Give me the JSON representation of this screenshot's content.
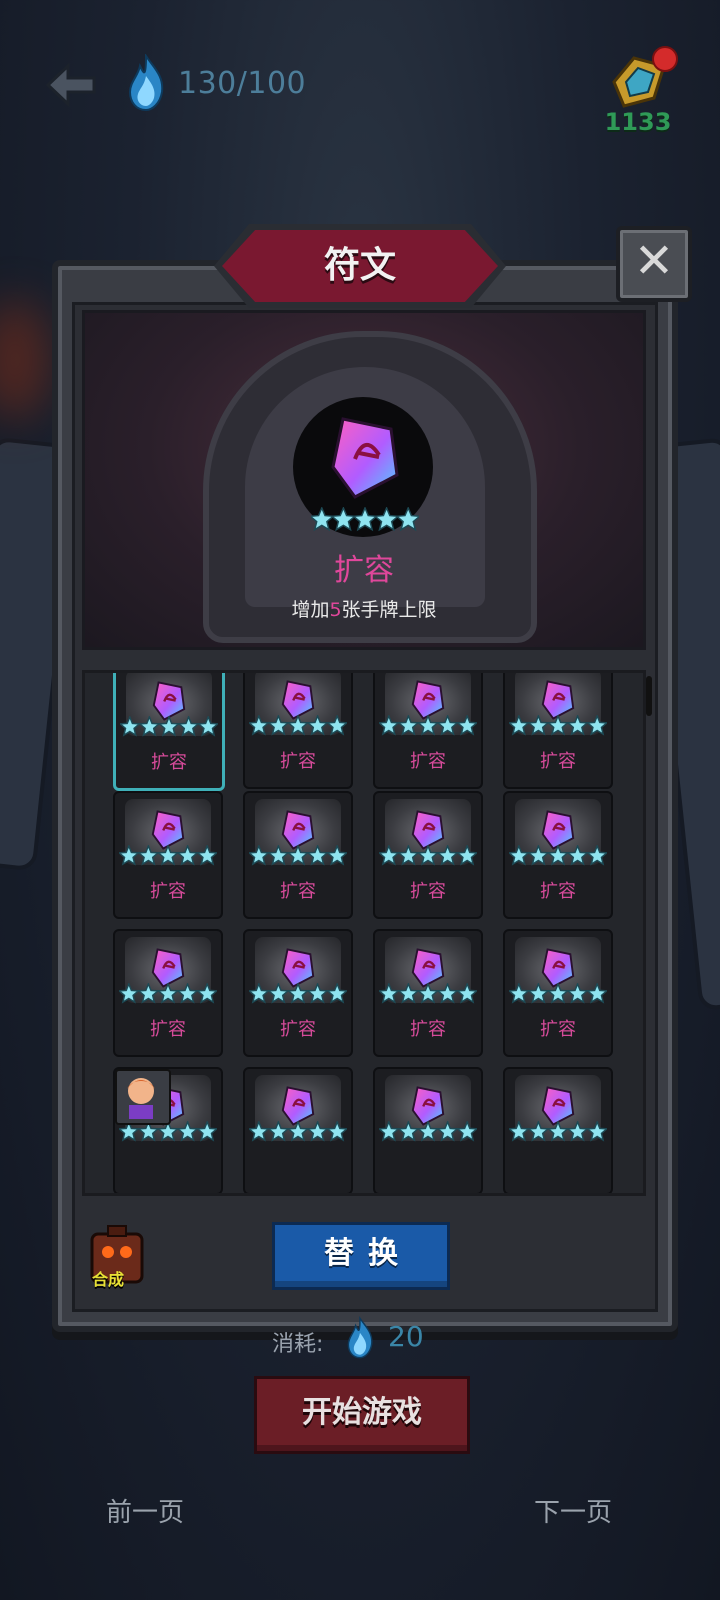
{
  "header": {
    "energy": "130/100",
    "coins": "1133"
  },
  "panel": {
    "title": "符文",
    "close_icon": "close-icon"
  },
  "preview": {
    "name": "扩容",
    "description_prefix": "增加",
    "description_number": "5",
    "description_suffix": "张手牌上限",
    "stars": 5
  },
  "grid": {
    "items": [
      {
        "label": "扩容",
        "stars": 5,
        "selected": true
      },
      {
        "label": "扩容",
        "stars": 5
      },
      {
        "label": "扩容",
        "stars": 5
      },
      {
        "label": "扩容",
        "stars": 5
      },
      {
        "label": "扩容",
        "stars": 5
      },
      {
        "label": "扩容",
        "stars": 5
      },
      {
        "label": "扩容",
        "stars": 5
      },
      {
        "label": "扩容",
        "stars": 5
      },
      {
        "label": "扩容",
        "stars": 5
      },
      {
        "label": "扩容",
        "stars": 5
      },
      {
        "label": "扩容",
        "stars": 5
      },
      {
        "label": "扩容",
        "stars": 5
      },
      {
        "label": "",
        "stars": 5,
        "avatar": true
      },
      {
        "label": "",
        "stars": 5
      },
      {
        "label": "",
        "stars": 5
      },
      {
        "label": "",
        "stars": 5
      }
    ]
  },
  "actions": {
    "merge_label": "合成",
    "swap_label": "替换",
    "cost_label": "消耗:",
    "cost_value": "20",
    "start_label": "开始游戏",
    "prev_page": "前一页",
    "next_page": "下一页"
  },
  "colors": {
    "accent_pink": "#e0479b",
    "star_cyan": "#8fe4f0",
    "swap_blue": "#1a5aa8",
    "start_red": "#6b1e26"
  }
}
